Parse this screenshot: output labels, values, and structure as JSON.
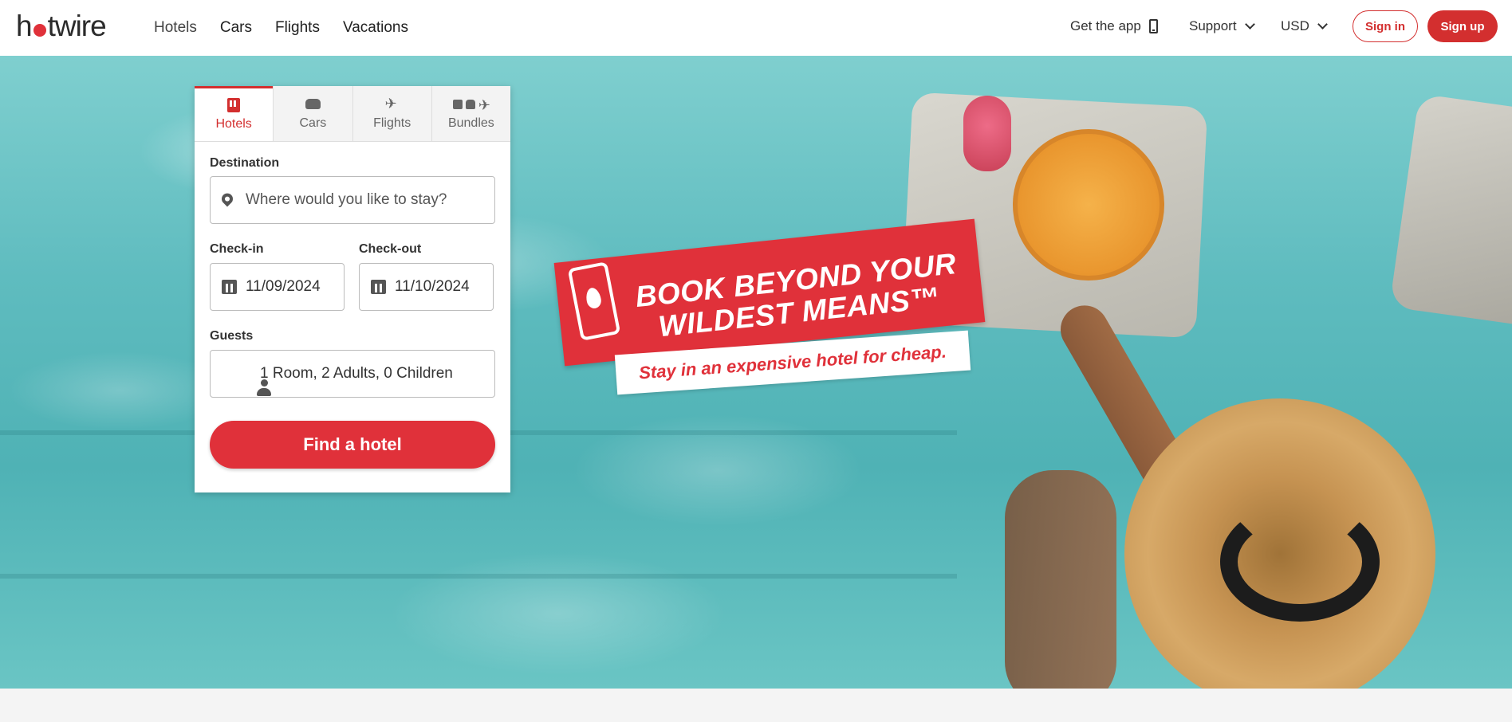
{
  "brand": {
    "logo_left": "h",
    "logo_right": "twire",
    "accent": "#e0313a"
  },
  "nav": {
    "items": [
      "Hotels",
      "Cars",
      "Flights",
      "Vacations"
    ]
  },
  "header_right": {
    "get_app": "Get the app",
    "support": "Support",
    "currency": "USD",
    "sign_in": "Sign in",
    "sign_up": "Sign up"
  },
  "search": {
    "tabs": [
      "Hotels",
      "Cars",
      "Flights",
      "Bundles"
    ],
    "active_tab": "Hotels",
    "destination_label": "Destination",
    "destination_placeholder": "Where would you like to stay?",
    "checkin_label": "Check-in",
    "checkin_value": "11/09/2024",
    "checkout_label": "Check-out",
    "checkout_value": "11/10/2024",
    "guests_label": "Guests",
    "guests_value": "1 Room, 2 Adults, 0 Children",
    "submit": "Find a hotel"
  },
  "hero": {
    "headline_line1": "BOOK BEYOND YOUR",
    "headline_line2": "WILDEST MEANS™",
    "subline": "Stay in an expensive hotel for cheap."
  }
}
